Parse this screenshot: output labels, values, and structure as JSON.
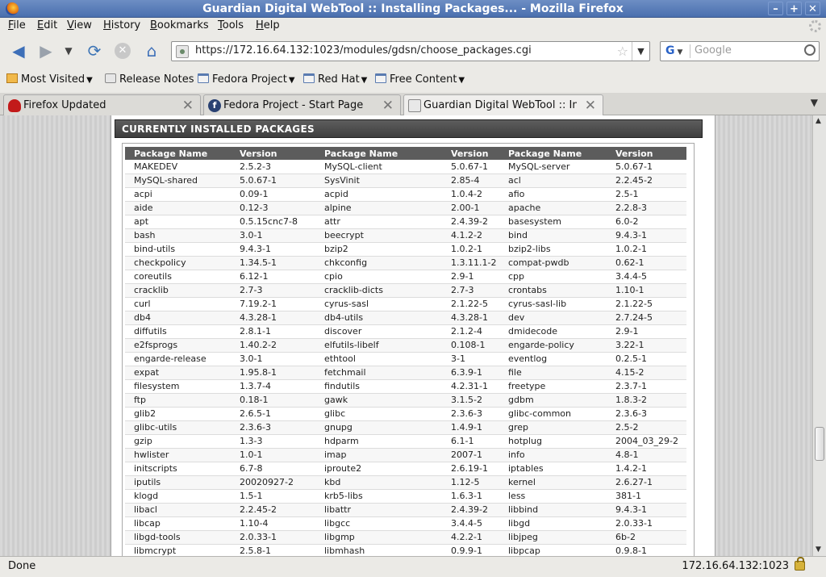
{
  "window": {
    "title": "Guardian Digital WebTool :: Installing Packages... - Mozilla Firefox"
  },
  "menu": [
    {
      "label": "File",
      "key": "F",
      "rest": "ile"
    },
    {
      "label": "Edit",
      "key": "E",
      "rest": "dit"
    },
    {
      "label": "View",
      "key": "V",
      "rest": "iew"
    },
    {
      "label": "History",
      "key": "H",
      "rest": "istory"
    },
    {
      "label": "Bookmarks",
      "key": "B",
      "rest": "ookmarks"
    },
    {
      "label": "Tools",
      "key": "T",
      "rest": "ools"
    },
    {
      "label": "Help",
      "key": "H",
      "rest": "elp"
    }
  ],
  "nav": {
    "url": "https://172.16.64.132:1023/modules/gdsn/choose_packages.cgi",
    "search_placeholder": "Google",
    "search_engine_letter": "G"
  },
  "bookmarks": [
    {
      "label": "Most Visited",
      "icon": "most-visited-icon",
      "menu": true
    },
    {
      "label": "Release Notes",
      "icon": "page-icon",
      "menu": false
    },
    {
      "label": "Fedora Project",
      "icon": "folder-icon",
      "menu": true
    },
    {
      "label": "Red Hat",
      "icon": "folder-icon",
      "menu": true
    },
    {
      "label": "Free Content",
      "icon": "folder-icon",
      "menu": true
    }
  ],
  "tabs": [
    {
      "label": "Firefox Updated",
      "icon": "redhat-icon"
    },
    {
      "label": "Fedora Project - Start Page",
      "icon": "fedora-icon"
    },
    {
      "label": "Guardian Digital WebTool :: In...",
      "icon": "page-icon",
      "active": true
    }
  ],
  "content": {
    "section_title": "CURRENTLY INSTALLED PACKAGES",
    "columns": [
      "Package Name",
      "Version",
      "Package Name",
      "Version",
      "Package Name",
      "Version"
    ],
    "rows": [
      [
        "MAKEDEV",
        "2.5.2-3",
        "MySQL-client",
        "5.0.67-1",
        "MySQL-server",
        "5.0.67-1"
      ],
      [
        "MySQL-shared",
        "5.0.67-1",
        "SysVinit",
        "2.85-4",
        "acl",
        "2.2.45-2"
      ],
      [
        "acpi",
        "0.09-1",
        "acpid",
        "1.0.4-2",
        "afio",
        "2.5-1"
      ],
      [
        "aide",
        "0.12-3",
        "alpine",
        "2.00-1",
        "apache",
        "2.2.8-3"
      ],
      [
        "apt",
        "0.5.15cnc7-8",
        "attr",
        "2.4.39-2",
        "basesystem",
        "6.0-2"
      ],
      [
        "bash",
        "3.0-1",
        "beecrypt",
        "4.1.2-2",
        "bind",
        "9.4.3-1"
      ],
      [
        "bind-utils",
        "9.4.3-1",
        "bzip2",
        "1.0.2-1",
        "bzip2-libs",
        "1.0.2-1"
      ],
      [
        "checkpolicy",
        "1.34.5-1",
        "chkconfig",
        "1.3.11.1-2",
        "compat-pwdb",
        "0.62-1"
      ],
      [
        "coreutils",
        "6.12-1",
        "cpio",
        "2.9-1",
        "cpp",
        "3.4.4-5"
      ],
      [
        "cracklib",
        "2.7-3",
        "cracklib-dicts",
        "2.7-3",
        "crontabs",
        "1.10-1"
      ],
      [
        "curl",
        "7.19.2-1",
        "cyrus-sasl",
        "2.1.22-5",
        "cyrus-sasl-lib",
        "2.1.22-5"
      ],
      [
        "db4",
        "4.3.28-1",
        "db4-utils",
        "4.3.28-1",
        "dev",
        "2.7.24-5"
      ],
      [
        "diffutils",
        "2.8.1-1",
        "discover",
        "2.1.2-4",
        "dmidecode",
        "2.9-1"
      ],
      [
        "e2fsprogs",
        "1.40.2-2",
        "elfutils-libelf",
        "0.108-1",
        "engarde-policy",
        "3.22-1"
      ],
      [
        "engarde-release",
        "3.0-1",
        "ethtool",
        "3-1",
        "eventlog",
        "0.2.5-1"
      ],
      [
        "expat",
        "1.95.8-1",
        "fetchmail",
        "6.3.9-1",
        "file",
        "4.15-2"
      ],
      [
        "filesystem",
        "1.3.7-4",
        "findutils",
        "4.2.31-1",
        "freetype",
        "2.3.7-1"
      ],
      [
        "ftp",
        "0.18-1",
        "gawk",
        "3.1.5-2",
        "gdbm",
        "1.8.3-2"
      ],
      [
        "glib2",
        "2.6.5-1",
        "glibc",
        "2.3.6-3",
        "glibc-common",
        "2.3.6-3"
      ],
      [
        "glibc-utils",
        "2.3.6-3",
        "gnupg",
        "1.4.9-1",
        "grep",
        "2.5-2"
      ],
      [
        "gzip",
        "1.3-3",
        "hdparm",
        "6.1-1",
        "hotplug",
        "2004_03_29-2"
      ],
      [
        "hwlister",
        "1.0-1",
        "imap",
        "2007-1",
        "info",
        "4.8-1"
      ],
      [
        "initscripts",
        "6.7-8",
        "iproute2",
        "2.6.19-1",
        "iptables",
        "1.4.2-1"
      ],
      [
        "iputils",
        "20020927-2",
        "kbd",
        "1.12-5",
        "kernel",
        "2.6.27-1"
      ],
      [
        "klogd",
        "1.5-1",
        "krb5-libs",
        "1.6.3-1",
        "less",
        "381-1"
      ],
      [
        "libacl",
        "2.2.45-2",
        "libattr",
        "2.4.39-2",
        "libbind",
        "9.4.3-1"
      ],
      [
        "libcap",
        "1.10-4",
        "libgcc",
        "3.4.4-5",
        "libgd",
        "2.0.33-1"
      ],
      [
        "libgd-tools",
        "2.0.33-1",
        "libgmp",
        "4.2.2-1",
        "libjpeg",
        "6b-2"
      ],
      [
        "libmcrypt",
        "2.5.8-1",
        "libmhash",
        "0.9.9-1",
        "libpcap",
        "0.9.8-1"
      ]
    ]
  },
  "status": {
    "text": "Done",
    "host": "172.16.64.132:1023"
  }
}
